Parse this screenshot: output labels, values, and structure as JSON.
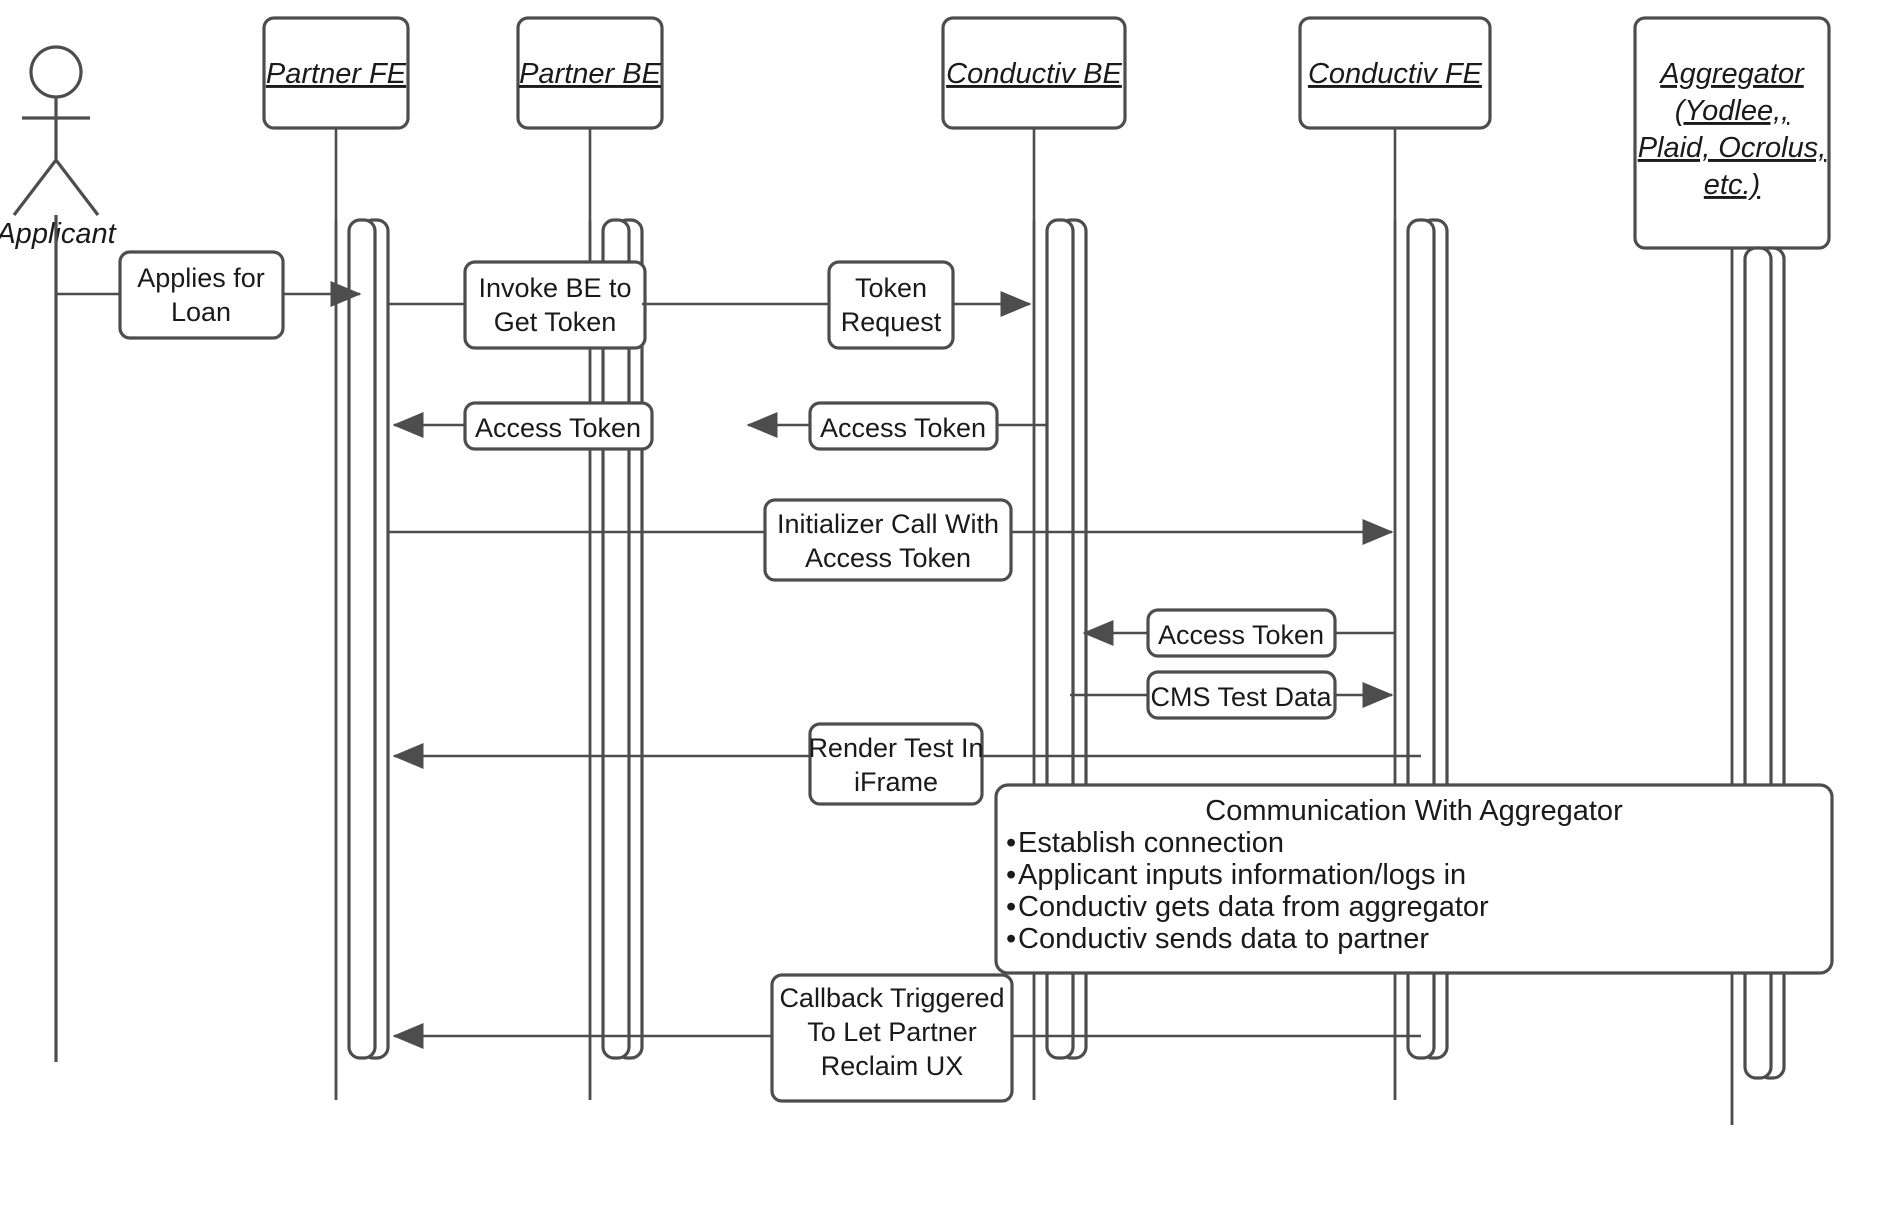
{
  "diagram": {
    "type": "uml-sequence-diagram",
    "background_color": "#ffffff",
    "line_color": "#4d4d4d",
    "text_color": "#1a1a1a"
  },
  "actor": {
    "label": "Applicant",
    "icon": "stick-figure-actor"
  },
  "lifelines": [
    {
      "id": "partner_fe",
      "label": "Partner FE"
    },
    {
      "id": "partner_be",
      "label": "Partner BE"
    },
    {
      "id": "conductiv_be",
      "label": "Conductiv BE"
    },
    {
      "id": "conductiv_fe",
      "label": "Conductiv FE"
    },
    {
      "id": "aggregator",
      "label_lines": [
        "Aggregator",
        "(Yodlee,,",
        "Plaid, Ocrolus,",
        "etc.)"
      ]
    }
  ],
  "messages": [
    {
      "id": "m1",
      "lines": [
        "Applies for",
        "Loan"
      ],
      "from": "applicant",
      "to": "partner_fe",
      "direction": "right"
    },
    {
      "id": "m2",
      "lines": [
        "Invoke BE to",
        "Get Token"
      ],
      "from": "partner_fe",
      "to": "partner_be",
      "direction": "right"
    },
    {
      "id": "m3",
      "lines": [
        "Token",
        "Request"
      ],
      "from": "partner_be",
      "to": "conductiv_be",
      "direction": "right"
    },
    {
      "id": "m4",
      "lines": [
        "Access Token"
      ],
      "from": "partner_be",
      "to": "partner_fe",
      "direction": "left"
    },
    {
      "id": "m5",
      "lines": [
        "Access Token"
      ],
      "from": "conductiv_be",
      "to": "partner_be",
      "direction": "left"
    },
    {
      "id": "m6",
      "lines": [
        "Initializer Call With",
        "Access Token"
      ],
      "from": "partner_fe",
      "to": "conductiv_fe",
      "direction": "right"
    },
    {
      "id": "m7",
      "lines": [
        "Access Token"
      ],
      "from": "conductiv_fe",
      "to": "conductiv_be",
      "direction": "left"
    },
    {
      "id": "m8",
      "lines": [
        "CMS Test Data"
      ],
      "from": "conductiv_be",
      "to": "conductiv_fe",
      "direction": "right"
    },
    {
      "id": "m9",
      "lines": [
        "Render Test In",
        "iFrame"
      ],
      "from": "conductiv_fe",
      "to": "partner_fe",
      "direction": "left"
    },
    {
      "id": "m10",
      "lines": [
        "Callback Triggered",
        "To Let Partner",
        "Reclaim UX"
      ],
      "from": "conductiv_fe",
      "to": "partner_fe",
      "direction": "left"
    }
  ],
  "note": {
    "title": "Communication With Aggregator",
    "bullet_marker": "•",
    "bullets": [
      "Establish connection",
      "Applicant inputs information/logs in",
      "Conductiv gets data from aggregator",
      "Conductiv sends data to partner"
    ]
  }
}
